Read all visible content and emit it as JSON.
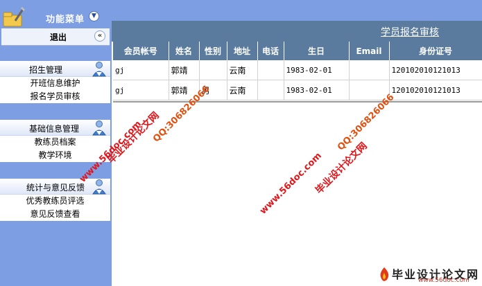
{
  "sidebar": {
    "title": "功能菜单",
    "toggle_icon": "chevron-down-icon",
    "logout_label": "退出",
    "collapse_icon": "double-chevron-left-icon",
    "groups": [
      {
        "title": "招生管理",
        "icon": "user-group-icon",
        "items": [
          "开班信息维护",
          "报名学员审核"
        ]
      },
      {
        "title": "基础信息管理",
        "icon": "user-group-icon",
        "items": [
          "教练员档案",
          "教学环境"
        ]
      },
      {
        "title": "统计与意见反馈",
        "icon": "user-group-icon",
        "items": [
          "优秀教练员评选",
          "意见反馈查看"
        ]
      }
    ]
  },
  "main": {
    "page_title": "学员报名审核",
    "table": {
      "columns": [
        "会员帐号",
        "姓名",
        "性别",
        "地址",
        "电话",
        "生日",
        "Email",
        "身份证号"
      ],
      "rows": [
        [
          "gj",
          "郭靖",
          "",
          "云南",
          "",
          "1983-02-01",
          "",
          "120102010121013"
        ],
        [
          "gj",
          "郭靖",
          "男",
          "云南",
          "",
          "1983-02-01",
          "",
          "120102010121013"
        ]
      ]
    }
  },
  "watermarks": {
    "text_a": "毕业设计论文网",
    "text_b": "www.56doc.com",
    "text_c": "QQ:306826066",
    "footer_title": "毕业设计论文网",
    "footer_url": "www.56doc.com"
  },
  "colors": {
    "sidebar_bg": "#7e9ee3",
    "header_bg": "#5a7b9e",
    "watermark_red": "#e0161a"
  }
}
